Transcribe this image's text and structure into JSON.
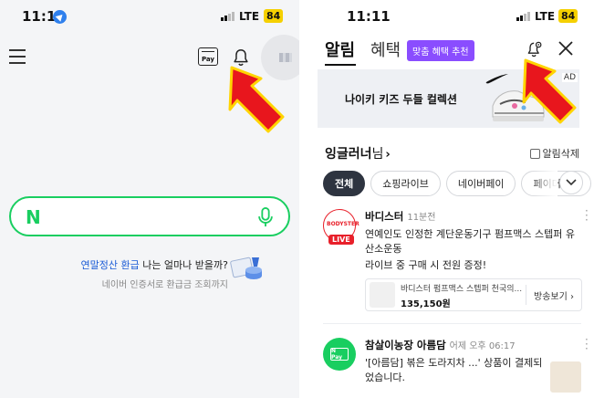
{
  "left_screen": {
    "status": {
      "time": "11:11",
      "network": "LTE",
      "battery": "84"
    },
    "pay_icon_label": "Pay",
    "search": {
      "logo": "N",
      "value": "",
      "placeholder": ""
    },
    "promo": {
      "highlight": "연말정산 환급",
      "title_rest": " 나는 얼마나 받을까?",
      "subtitle": "네이버 인증서로 환급금 조회까지"
    }
  },
  "right_screen": {
    "status": {
      "time": "11:11",
      "network": "LTE",
      "battery": "84"
    },
    "tabs": {
      "alarm": "알림",
      "benefit": "혜택",
      "benefit_badge": "맞춤 혜택 추천"
    },
    "ad": {
      "text": "나이키 키즈 두들 컬렉션",
      "label": "AD"
    },
    "user": {
      "name": "잉글러너",
      "suffix": "님",
      "chevron": "›",
      "delete_all": "알림삭제"
    },
    "chips": [
      "전체",
      "쇼핑라이브",
      "네이버페이",
      "페이머니송"
    ],
    "notifications": [
      {
        "sender": "바디스터",
        "time": "11분전",
        "badge": "LIVE",
        "avatar_text": "BODYSTER",
        "line1": "연예인도 인정한 계단운동기구 펌프맥스 스텝퍼 유산소운동",
        "line2": "라이브 중 구매 시 전원 증정!",
        "product": {
          "name": "바디스터 펌프맥스 스텝퍼 천국의...",
          "price": "135,150원",
          "button": "방송보기 ›"
        }
      },
      {
        "sender": "참살이농장 아름담",
        "time": "어제 오후 06:17",
        "avatar_text": "N Pay",
        "line1": "'[아름담] 볶은 도라지차 ...' 상품이 결제되었습니다."
      }
    ]
  },
  "colors": {
    "naver_green": "#19ce60",
    "arrow_red": "#e8161d",
    "arrow_yellow": "#ffd400",
    "benefit_purple": "#8a4dff",
    "promo_blue": "#1a5bd6"
  },
  "icons": [
    "hamburger-icon",
    "pay-icon",
    "bell-icon",
    "mic-icon",
    "gear-bell-icon",
    "close-icon",
    "check-icon",
    "chevron-down-icon",
    "kebab-icon"
  ]
}
